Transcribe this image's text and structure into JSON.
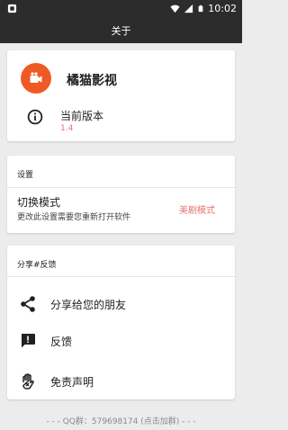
{
  "status_bar": {
    "time": "10:02",
    "icons": [
      "app-notification-icon",
      "wifi-icon",
      "signal-icon",
      "battery-icon"
    ]
  },
  "toolbar": {
    "title": "关于"
  },
  "app_card": {
    "app_name": "橘猫影视",
    "logo_color": "#ee5a24",
    "version_label": "当前版本",
    "version_value": "1.4"
  },
  "settings": {
    "section_title": "设置",
    "mode_label": "切换模式",
    "mode_description": "更改此设置需要您重新打开软件",
    "mode_value": "美剧模式"
  },
  "share_feedback": {
    "section_title": "分享#反馈",
    "items": [
      {
        "label": "分享给您的朋友",
        "icon": "share-icon"
      },
      {
        "label": "反馈",
        "icon": "feedback-icon"
      },
      {
        "label": "免责声明",
        "icon": "disclaimer-icon"
      }
    ]
  },
  "footer": {
    "text": "- - - QQ群：579698174 (点击加群) - - -"
  },
  "colors": {
    "accent": "#e57373",
    "bar": "#2c2c2c",
    "logo": "#ee5a24"
  }
}
